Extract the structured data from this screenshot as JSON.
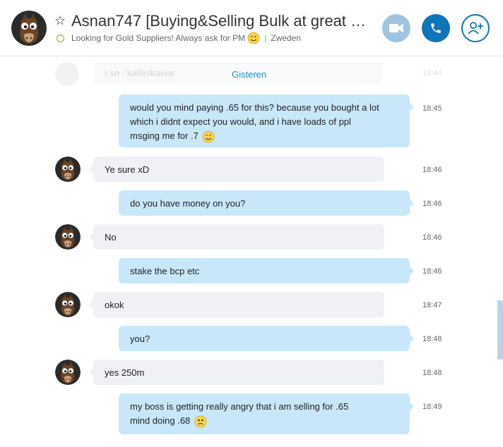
{
  "header": {
    "title": "Asnan747 [Buying&Selling Bulk at great rat...",
    "mood": "Looking for Gold Suppliers!  Always ask for PM",
    "location": "Zweden",
    "status_color": "#7fba00",
    "icons": [
      "star-icon",
      "video-call-icon",
      "phone-icon",
      "add-person-icon"
    ]
  },
  "chat": {
    "date_separator": "Gisteren",
    "ghost": {
      "text": "I.sn : kalleskaviar",
      "time": "18:44"
    },
    "messages": [
      {
        "dir": "out",
        "text": "would you mind paying .65 for this? because you bought a lot which i didnt expect you would, and i have loads of ppl msging me for .7",
        "emoji": "smile",
        "time": "18:45"
      },
      {
        "dir": "in",
        "text": "Ye sure xD",
        "time": "18:46"
      },
      {
        "dir": "out",
        "text": "do you have money on you?",
        "time": "18:46"
      },
      {
        "dir": "in",
        "text": "No",
        "time": "18:46"
      },
      {
        "dir": "out",
        "text": "stake the bcp etc",
        "time": "18:46"
      },
      {
        "dir": "in",
        "text": "okok",
        "time": "18:47"
      },
      {
        "dir": "out",
        "text": "you?",
        "time": "18:48"
      },
      {
        "dir": "in",
        "text": "yes 250m",
        "time": "18:48"
      },
      {
        "dir": "out",
        "text": "my boss is getting really angry that i am selling for .65 mind doing .68",
        "emoji": "worried",
        "time": "18:49"
      }
    ]
  },
  "colors": {
    "outgoing_bubble": "#c8e8fa",
    "incoming_bubble": "#eff1f5",
    "accent": "#0d75b8"
  }
}
